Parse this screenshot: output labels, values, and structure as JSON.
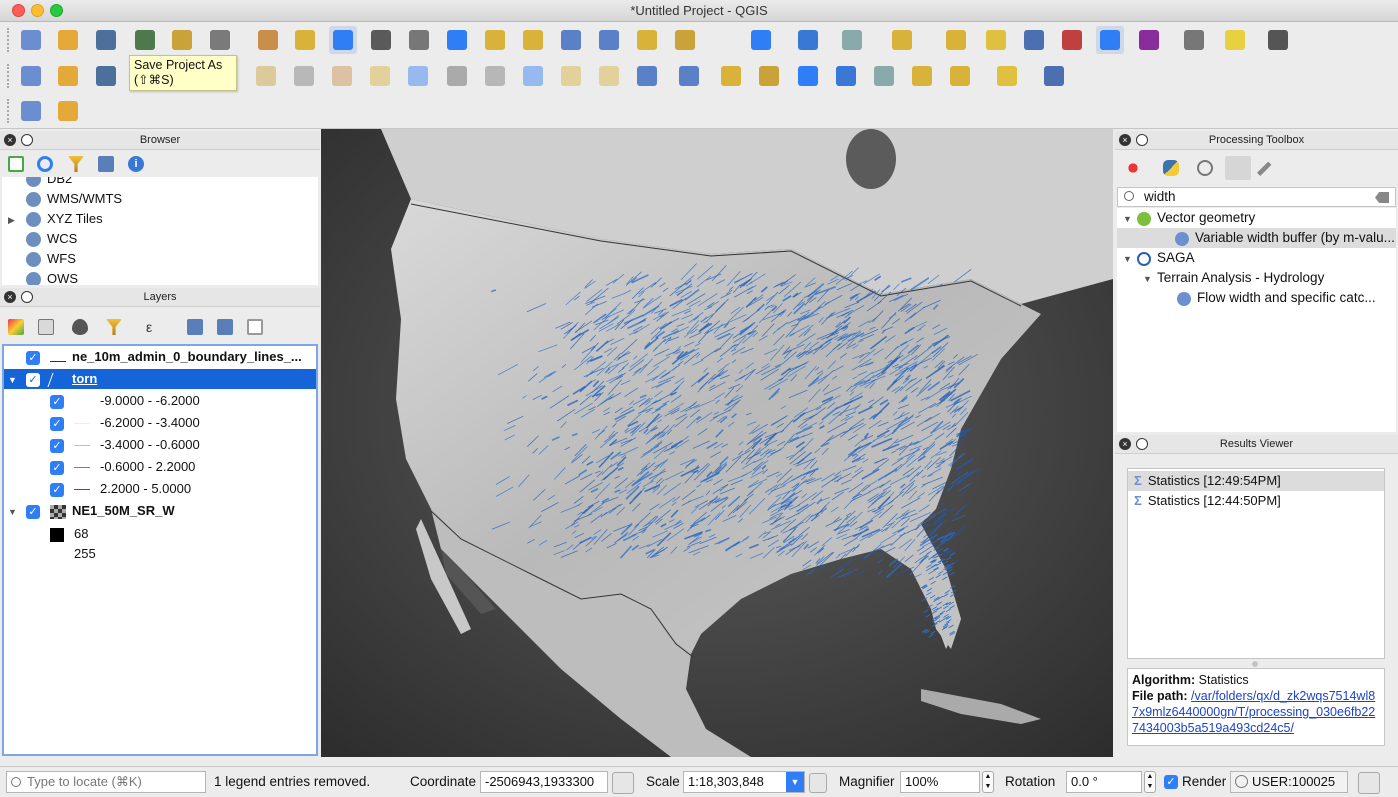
{
  "window": {
    "title": "*Untitled Project - QGIS"
  },
  "toolbar": {
    "row1": [
      "new-project",
      "open-project",
      "save-project",
      "save-project-as",
      "print-composer",
      "layout-manager",
      "pan",
      "pan-to-selection",
      "zoom-in",
      "zoom-out",
      "zoom-native",
      "zoom-full",
      "zoom-to-selection",
      "zoom-to-layer",
      "zoom-last",
      "zoom-next",
      "new-bookmark",
      "show-bookmarks",
      "refresh",
      "identify",
      "run-feature-action",
      "select-features",
      "attribute-select",
      "deselect",
      "open-attribute-table",
      "statistical-summary",
      "processing-toolbox",
      "field-calculator",
      "measure",
      "map-tips",
      "text-annotation"
    ],
    "row2": [
      "add-layer",
      "add-vector",
      "digitize",
      "edit-pencil",
      "save-edits",
      "add-feature",
      "node-tool",
      "edit-attributes",
      "delete",
      "cut",
      "copy",
      "paste",
      "undo",
      "redo",
      "label-abc",
      "diagram",
      "layer-labeling",
      "pin-labels",
      "show-labels",
      "move-label",
      "rotate-label",
      "change-label",
      "ogc-plugin",
      "python-console",
      "help"
    ],
    "row3": [
      "plugin-add",
      "plugin-tool"
    ]
  },
  "tooltip": {
    "title": "Save Project As",
    "shortcut": "(⇧⌘S)"
  },
  "browser": {
    "title": "Browser",
    "items": [
      {
        "label": "DB2",
        "expand": false
      },
      {
        "label": "WMS/WMTS",
        "expand": false
      },
      {
        "label": "XYZ Tiles",
        "expand": true
      },
      {
        "label": "WCS",
        "expand": false
      },
      {
        "label": "WFS",
        "expand": false
      },
      {
        "label": "OWS",
        "expand": false
      }
    ]
  },
  "layers": {
    "title": "Layers",
    "items": [
      {
        "label": "ne_10m_admin_0_boundary_lines_...",
        "bold": true,
        "checked": true,
        "level": 0
      },
      {
        "label": "torn",
        "bold": true,
        "checked": true,
        "level": 0,
        "selected": true,
        "expanded": true
      },
      {
        "label": "-9.0000 - -6.2000",
        "checked": true,
        "level": 1
      },
      {
        "label": "-6.2000 - -3.4000",
        "checked": true,
        "level": 1
      },
      {
        "label": "-3.4000 - -0.6000",
        "checked": true,
        "level": 1
      },
      {
        "label": "-0.6000 - 2.2000",
        "checked": true,
        "level": 1
      },
      {
        "label": "2.2000 - 5.0000",
        "checked": true,
        "level": 1
      },
      {
        "label": "NE1_50M_SR_W",
        "bold": true,
        "checked": true,
        "level": 0,
        "expanded": true
      },
      {
        "label": "68",
        "level": 1
      },
      {
        "label": "255",
        "level": 1
      }
    ],
    "range_colors": [
      "#ffffff",
      "#e8eef7",
      "#a9c3e6",
      "#4e86d0",
      "#1d5bb5"
    ]
  },
  "processing": {
    "title": "Processing Toolbox",
    "search_value": "width",
    "tree": [
      {
        "label": "Vector geometry",
        "level": 0
      },
      {
        "label": "Variable width buffer (by m-valu...",
        "level": 1,
        "selected": true
      },
      {
        "label": "SAGA",
        "level": 0
      },
      {
        "label": "Terrain Analysis - Hydrology",
        "level": 1
      },
      {
        "label": "Flow width and specific catc...",
        "level": 2
      }
    ]
  },
  "results": {
    "title": "Results Viewer",
    "items": [
      "Statistics [12:49:54PM]",
      "Statistics [12:44:50PM]"
    ],
    "algorithm_label": "Algorithm:",
    "algorithm_value": "Statistics",
    "filepath_label": "File path:",
    "filepath_value": "/var/folders/qx/d_zk2wqs7514wl87x9mlz6440000gn/T/processing_030e6fb227434003b5a519a493cd24c5/"
  },
  "status": {
    "locate_placeholder": "Type to locate (⌘K)",
    "message": "1 legend entries removed.",
    "coordinate_label": "Coordinate",
    "coordinate_value": "-2506943,1933300",
    "scale_label": "Scale",
    "scale_value": "1:18,303,848",
    "magnifier_label": "Magnifier",
    "magnifier_value": "100%",
    "rotation_label": "Rotation",
    "rotation_value": "0.0 °",
    "render_label": "Render",
    "crs_value": "USER:100025"
  },
  "colors": {
    "accent": "#2f7ef6",
    "selection": "#1565d8",
    "tornado": "#2a6fc9"
  }
}
